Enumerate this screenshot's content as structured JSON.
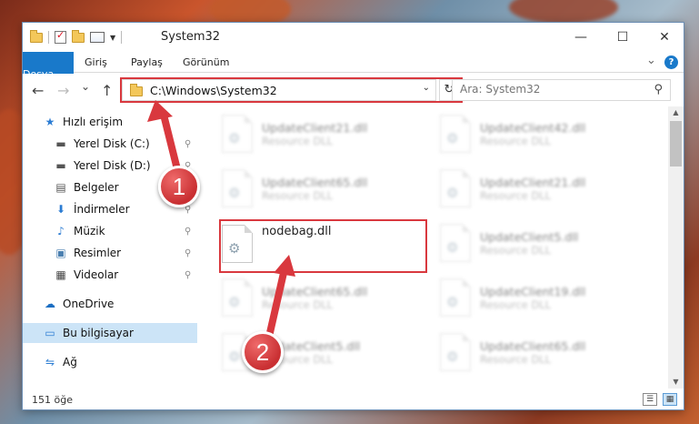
{
  "window": {
    "title": "System32",
    "minimize_glyph": "—",
    "maximize_glyph": "☐",
    "close_glyph": "✕"
  },
  "ribbon": {
    "tabs": [
      "Dosya",
      "Giriş",
      "Paylaş",
      "Görünüm"
    ],
    "expand_glyph": "⌄",
    "help_glyph": "?"
  },
  "nav": {
    "back_glyph": "←",
    "forward_glyph": "→",
    "recent_glyph": "⌄",
    "up_glyph": "↑",
    "address": "C:\\Windows\\System32",
    "address_drop_glyph": "⌄",
    "refresh_glyph": "↻",
    "search_placeholder": "Ara: System32",
    "search_glyph": "⚲"
  },
  "sidebar": {
    "items": [
      {
        "label": "Hızlı erişim",
        "icon": "star-icon",
        "glyph": "★"
      },
      {
        "label": "Yerel Disk (C:)",
        "icon": "drive-icon",
        "glyph": "▬"
      },
      {
        "label": "Yerel Disk (D:)",
        "icon": "drive-icon",
        "glyph": "▬"
      },
      {
        "label": "Belgeler",
        "icon": "document-icon",
        "glyph": "▤"
      },
      {
        "label": "İndirmeler",
        "icon": "download-icon",
        "glyph": "⬇"
      },
      {
        "label": "Müzik",
        "icon": "music-icon",
        "glyph": "♪"
      },
      {
        "label": "Resimler",
        "icon": "pictures-icon",
        "glyph": "▣"
      },
      {
        "label": "Videolar",
        "icon": "video-icon",
        "glyph": "▦"
      },
      {
        "label": "OneDrive",
        "icon": "cloud-icon",
        "glyph": "☁"
      },
      {
        "label": "Bu bilgisayar",
        "icon": "computer-icon",
        "glyph": "▭"
      },
      {
        "label": "Ağ",
        "icon": "network-icon",
        "glyph": "⇋"
      }
    ],
    "pin_glyph": "📌"
  },
  "files": [
    {
      "name": "UpdateClient21.dll",
      "desc": "Resource DLL"
    },
    {
      "name": "UpdateClient42.dll",
      "desc": "Resource DLL"
    },
    {
      "name": "UpdateClient65.dll",
      "desc": "Resource DLL"
    },
    {
      "name": "UpdateClient21.dll",
      "desc": "Resource DLL"
    },
    {
      "name": "nodebag.dll",
      "desc": ""
    },
    {
      "name": "UpdateClient5.dll",
      "desc": "Resource DLL"
    },
    {
      "name": "UpdateClient65.dll",
      "desc": "Resource DLL"
    },
    {
      "name": "UpdateClient19.dll",
      "desc": "Resource DLL"
    },
    {
      "name": "UpdateClient5.dll",
      "desc": "Resource DLL"
    },
    {
      "name": "UpdateClient65.dll",
      "desc": "Resource DLL"
    }
  ],
  "status": {
    "count": "151 öğe"
  },
  "annotations": {
    "step1": "1",
    "step2": "2"
  },
  "colors": {
    "accent": "#1979ca",
    "highlight": "#d9383e",
    "selection": "#cce4f7"
  }
}
